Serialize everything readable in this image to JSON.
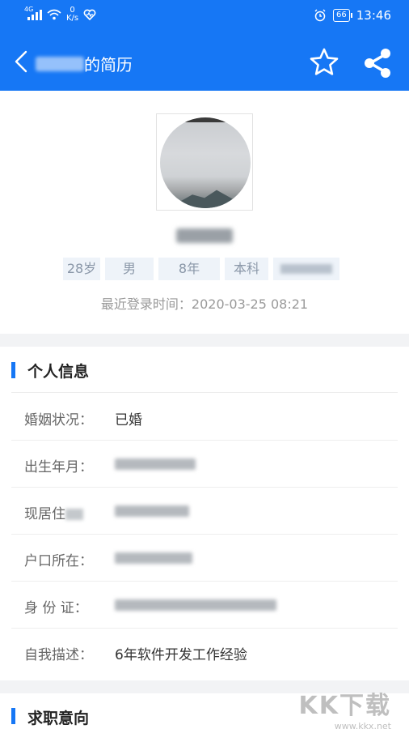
{
  "status_bar": {
    "network": "4G",
    "speed_value": "0",
    "speed_unit": "K/s",
    "battery": "66",
    "time": "13:46",
    "icons": [
      "signal-icon",
      "wifi-icon",
      "heart-icon",
      "alarm-icon",
      "battery-icon"
    ]
  },
  "header": {
    "title_suffix": "的简历",
    "colors": {
      "primary": "#1677f5"
    },
    "icons": [
      "chevron-left-icon",
      "star-icon",
      "share-icon"
    ]
  },
  "profile": {
    "tags": [
      "28岁",
      "男",
      "8年",
      "本科"
    ],
    "last_login_label": "最近登录时间：",
    "last_login_time": "2020-03-25 08:21"
  },
  "personal_info": {
    "title": "个人信息",
    "rows": [
      {
        "label": "婚姻状况：",
        "value": "已婚"
      },
      {
        "label": "出生年月：",
        "value": ""
      },
      {
        "label": "现居住",
        "value": ""
      },
      {
        "label": "户口所在：",
        "value": ""
      },
      {
        "label": "身 份 证：",
        "value": ""
      },
      {
        "label": "自我描述：",
        "value": "6年软件开发工作经验"
      }
    ]
  },
  "job_intention": {
    "title": "求职意向"
  },
  "watermark": {
    "brand": "KK下载",
    "url": "www.kkx.net"
  }
}
